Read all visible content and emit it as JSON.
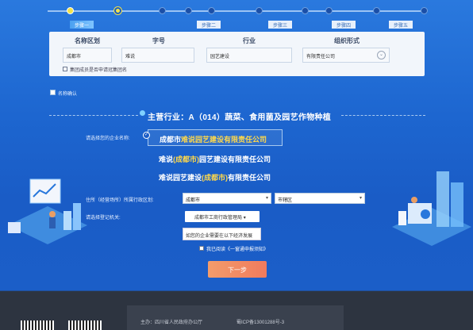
{
  "steps": [
    {
      "label": "步骤一"
    },
    {
      "label": "步骤二"
    },
    {
      "label": "步骤三"
    },
    {
      "label": "步骤四"
    },
    {
      "label": "步骤五"
    }
  ],
  "name_form": {
    "headers": [
      "名称区划",
      "字号",
      "行业",
      "组织形式"
    ],
    "region_value": "成都市",
    "brand_value": "难说",
    "industry_value": "园艺建设",
    "org_form_value": "有限责任公司",
    "member_label": "集团成员是否申请冠集团名"
  },
  "section": {
    "name_confirm_label": "名称确认",
    "industry_title": "主营行业：A（014）蔬菜、食用菌及园艺作物种植"
  },
  "company_select": {
    "label": "请选择您的企业名称:",
    "selected_prefix": "成都市",
    "selected_highlight": "难说园艺建设有限责任公司",
    "option2_a": "难说",
    "option2_b": "(成都市)",
    "option2_c": "园艺建设有限责任公司",
    "option3_a": "难说园艺建设",
    "option3_b": "(成都市)",
    "option3_c": "有限责任公司"
  },
  "location": {
    "label": "住所（经营场所）所属行政区划:",
    "city": "成都市",
    "district": "市辖区"
  },
  "registration": {
    "label": "请选择登记机关:",
    "authority": "成都市工商行政管理局",
    "hint": "如您的企业需要在以下经济发展"
  },
  "agree_text": "我已阅读《一窗通申报须知》",
  "next_button": "下一步",
  "footer": {
    "host": "主办：四川省人民政府办公厅",
    "icp": "蜀ICP备13001288号-3"
  },
  "colors": {
    "accent_yellow": "#ffd84a",
    "next_button": "#f07b5d"
  }
}
